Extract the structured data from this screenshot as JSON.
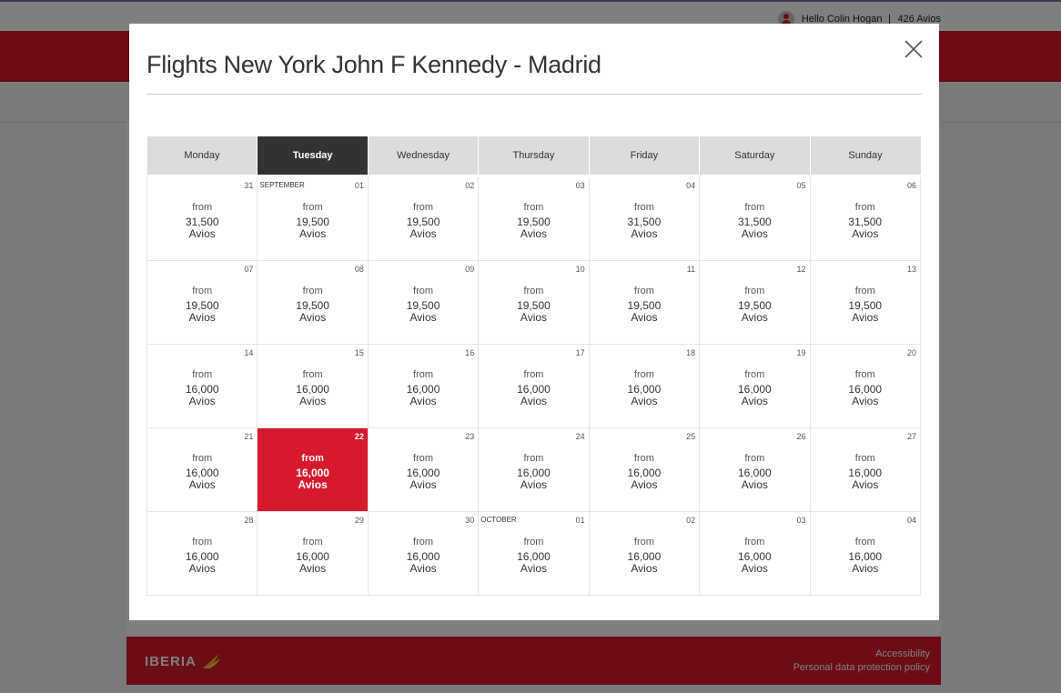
{
  "header": {
    "greeting": "Hello Colin Hogan",
    "avios_balance": "426 Avios"
  },
  "modal": {
    "title": "Flights New York John F Kennedy - Madrid"
  },
  "footer": {
    "brand": "IBERIA",
    "links": [
      "Accessibility",
      "Personal data protection policy"
    ]
  },
  "calendar": {
    "weekdays": [
      "Monday",
      "Tuesday",
      "Wednesday",
      "Thursday",
      "Friday",
      "Saturday",
      "Sunday"
    ],
    "active_weekday": "Tuesday",
    "from_label": "from",
    "unit_label": "Avios",
    "weeks": [
      [
        {
          "day": "31",
          "price": "31,500"
        },
        {
          "day": "01",
          "price": "19,500",
          "month": "SEPTEMBER"
        },
        {
          "day": "02",
          "price": "19,500"
        },
        {
          "day": "03",
          "price": "19,500"
        },
        {
          "day": "04",
          "price": "31,500"
        },
        {
          "day": "05",
          "price": "31,500"
        },
        {
          "day": "06",
          "price": "31,500"
        }
      ],
      [
        {
          "day": "07",
          "price": "19,500"
        },
        {
          "day": "08",
          "price": "19,500"
        },
        {
          "day": "09",
          "price": "19,500"
        },
        {
          "day": "10",
          "price": "19,500"
        },
        {
          "day": "11",
          "price": "19,500"
        },
        {
          "day": "12",
          "price": "19,500"
        },
        {
          "day": "13",
          "price": "19,500"
        }
      ],
      [
        {
          "day": "14",
          "price": "16,000"
        },
        {
          "day": "15",
          "price": "16,000"
        },
        {
          "day": "16",
          "price": "16,000"
        },
        {
          "day": "17",
          "price": "16,000"
        },
        {
          "day": "18",
          "price": "16,000"
        },
        {
          "day": "19",
          "price": "16,000"
        },
        {
          "day": "20",
          "price": "16,000"
        }
      ],
      [
        {
          "day": "21",
          "price": "16,000"
        },
        {
          "day": "22",
          "price": "16,000",
          "selected": true
        },
        {
          "day": "23",
          "price": "16,000"
        },
        {
          "day": "24",
          "price": "16,000"
        },
        {
          "day": "25",
          "price": "16,000"
        },
        {
          "day": "26",
          "price": "16,000"
        },
        {
          "day": "27",
          "price": "16,000"
        }
      ],
      [
        {
          "day": "28",
          "price": "16,000"
        },
        {
          "day": "29",
          "price": "16,000"
        },
        {
          "day": "30",
          "price": "16,000"
        },
        {
          "day": "01",
          "price": "16,000",
          "month": "OCTOBER"
        },
        {
          "day": "02",
          "price": "16,000"
        },
        {
          "day": "03",
          "price": "16,000"
        },
        {
          "day": "04",
          "price": "16,000"
        }
      ]
    ]
  },
  "colors": {
    "brand_red": "#d7192d",
    "active_header": "#333333",
    "header_gray": "#dcdcdc"
  }
}
